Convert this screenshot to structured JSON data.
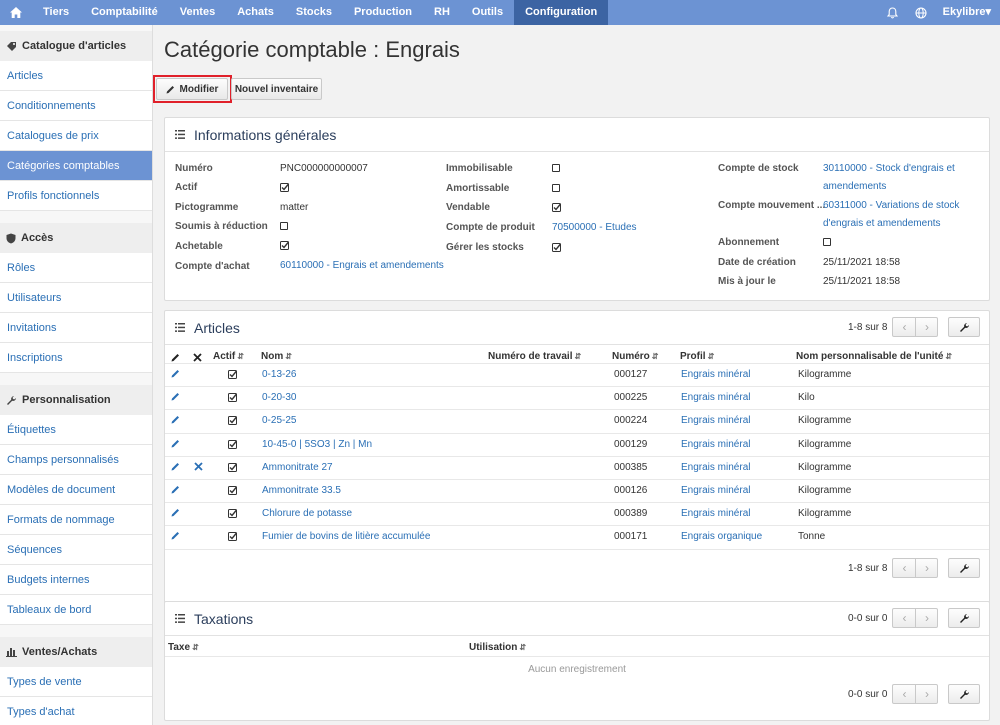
{
  "topnav": {
    "items": [
      "Tiers",
      "Comptabilité",
      "Ventes",
      "Achats",
      "Stocks",
      "Production",
      "RH",
      "Outils",
      "Configuration"
    ],
    "active": "Configuration",
    "user": "Ekylibre▾"
  },
  "sidebar": {
    "sections": [
      {
        "title": "Catalogue d'articles",
        "icon": "tag-icon",
        "items": [
          "Articles",
          "Conditionnements",
          "Catalogues de prix",
          "Catégories comptables",
          "Profils fonctionnels"
        ],
        "active": 3
      },
      {
        "title": "Accès",
        "icon": "shield-icon",
        "items": [
          "Rôles",
          "Utilisateurs",
          "Invitations",
          "Inscriptions"
        ]
      },
      {
        "title": "Personnalisation",
        "icon": "wrench-icon",
        "items": [
          "Étiquettes",
          "Champs personnalisés",
          "Modèles de document",
          "Formats de nommage",
          "Séquences",
          "Budgets internes",
          "Tableaux de bord"
        ]
      },
      {
        "title": "Ventes/Achats",
        "icon": "bar-chart-icon",
        "items": [
          "Types de vente",
          "Types d'achat"
        ]
      }
    ]
  },
  "page": {
    "title": "Catégorie comptable : Engrais",
    "modify_label": "Modifier",
    "inventory_label": "Nouvel inventaire"
  },
  "info": {
    "title": "Informations générales",
    "col1": {
      "numero_label": "Numéro",
      "numero_value": "PNC000000000007",
      "actif_label": "Actif",
      "actif_checked": true,
      "picto_label": "Pictogramme",
      "picto_value": "matter",
      "reduction_label": "Soumis à réduction",
      "reduction_checked": false,
      "achetable_label": "Achetable",
      "achetable_checked": true,
      "compte_achat_label": "Compte d'achat",
      "compte_achat_value": "60110000 - Engrais et amendements"
    },
    "col2": {
      "immo_label": "Immobilisable",
      "immo_checked": false,
      "amort_label": "Amortissable",
      "amort_checked": false,
      "vendable_label": "Vendable",
      "vendable_checked": true,
      "compte_produit_label": "Compte de produit",
      "compte_produit_value": "70500000 - Etudes",
      "stocks_label": "Gérer les stocks",
      "stocks_checked": true
    },
    "col3": {
      "compte_stock_label": "Compte de stock",
      "compte_stock_value_1": "30110000 - Stock d'engrais et",
      "compte_stock_value_2": "amendements",
      "compte_mvt_label": "Compte mouvement ...",
      "compte_mvt_value_1": "60311000 - Variations de stock",
      "compte_mvt_value_2": "d'engrais et amendements",
      "abonnement_label": "Abonnement",
      "abonnement_checked": false,
      "creation_label": "Date de création",
      "creation_value": "25/11/2021 18:58",
      "maj_label": "Mis à jour le",
      "maj_value": "25/11/2021 18:58"
    }
  },
  "articles": {
    "title": "Articles",
    "pager": "1-8 sur 8",
    "headers": {
      "actif": "Actif",
      "nom": "Nom",
      "travail": "Numéro de travail",
      "numero": "Numéro",
      "profil": "Profil",
      "unite": "Nom personnalisable de l'unité"
    },
    "rows": [
      {
        "nom": "0-13-26",
        "numero": "000127",
        "profil": "Engrais minéral",
        "unite": "Kilogramme",
        "deletable": false
      },
      {
        "nom": "0-20-30",
        "numero": "000225",
        "profil": "Engrais minéral",
        "unite": "Kilo",
        "deletable": false
      },
      {
        "nom": "0-25-25",
        "numero": "000224",
        "profil": "Engrais minéral",
        "unite": "Kilogramme",
        "deletable": false
      },
      {
        "nom": "10-45-0 | 5SO3 | Zn | Mn",
        "numero": "000129",
        "profil": "Engrais minéral",
        "unite": "Kilogramme",
        "deletable": false
      },
      {
        "nom": "Ammonitrate 27",
        "numero": "000385",
        "profil": "Engrais minéral",
        "unite": "Kilogramme",
        "deletable": true
      },
      {
        "nom": "Ammonitrate 33.5",
        "numero": "000126",
        "profil": "Engrais minéral",
        "unite": "Kilogramme",
        "deletable": false
      },
      {
        "nom": "Chlorure de potasse",
        "numero": "000389",
        "profil": "Engrais minéral",
        "unite": "Kilogramme",
        "deletable": false
      },
      {
        "nom": "Fumier de bovins de litière accumulée",
        "numero": "000171",
        "profil": "Engrais organique",
        "unite": "Tonne",
        "deletable": false
      }
    ]
  },
  "taxations": {
    "title": "Taxations",
    "pager": "0-0 sur 0",
    "headers": {
      "taxe": "Taxe",
      "utilisation": "Utilisation"
    },
    "empty": "Aucun enregistrement"
  }
}
